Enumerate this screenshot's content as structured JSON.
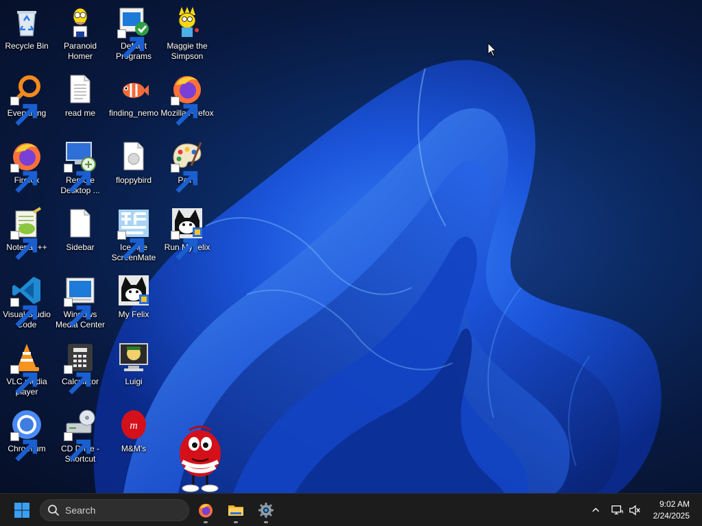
{
  "desktop": {
    "icons": [
      {
        "label": "Recycle Bin"
      },
      {
        "label": "Paranoid Homer"
      },
      {
        "label": "Default Programs"
      },
      {
        "label": "Maggie the Simpson"
      },
      {
        "label": "Everything"
      },
      {
        "label": "read me"
      },
      {
        "label": "finding_nemo"
      },
      {
        "label": "Mozilla Firefox"
      },
      {
        "label": "Firefox"
      },
      {
        "label": "Remote Desktop ..."
      },
      {
        "label": "floppybird"
      },
      {
        "label": "Paint"
      },
      {
        "label": "Notepad++"
      },
      {
        "label": "Sidebar"
      },
      {
        "label": "Ice Age ScreenMate"
      },
      {
        "label": "Run MyFelix"
      },
      {
        "label": "Visual Studio Code"
      },
      {
        "label": "Windows Media Center"
      },
      {
        "label": "My Felix"
      },
      {
        "label": "VLC media player"
      },
      {
        "label": "Calculator"
      },
      {
        "label": "Luigi"
      },
      {
        "label": "Chromium"
      },
      {
        "label": "CD Drive - Shortcut"
      },
      {
        "label": "M&M's"
      }
    ]
  },
  "taskbar": {
    "search_placeholder": "Search",
    "pinned": [
      {
        "name": "firefox-icon"
      },
      {
        "name": "file-explorer-icon"
      },
      {
        "name": "settings-icon"
      }
    ],
    "clock": {
      "time": "9:02 AM",
      "date": "2/24/2025"
    }
  },
  "colors": {
    "taskbar_bg": "#1c1c1c",
    "wallpaper_blue": "#1e5fe8",
    "wallpaper_dark": "#071634"
  }
}
